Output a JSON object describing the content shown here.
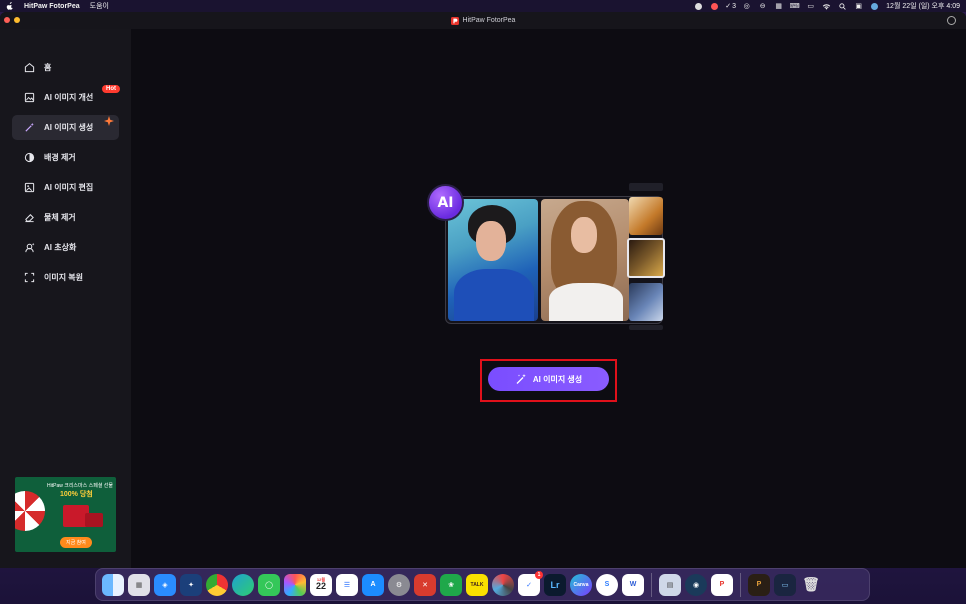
{
  "menubar": {
    "app_name": "HitPaw FotorPea",
    "menus": [
      "도움이"
    ],
    "badge_count": "3",
    "clock": "12월 22일 (일) 오후 4:09"
  },
  "window": {
    "title": "HitPaw FotorPea"
  },
  "sidebar": {
    "items": [
      {
        "label": "홈",
        "icon": "home-icon"
      },
      {
        "label": "AI 이미지 개선",
        "icon": "image-enhance-icon",
        "badge": "Hot"
      },
      {
        "label": "AI 이미지 생성",
        "icon": "magic-wand-icon",
        "active": true
      },
      {
        "label": "배경 제거",
        "icon": "background-remove-icon"
      },
      {
        "label": "AI 이미지 편집",
        "icon": "image-edit-icon"
      },
      {
        "label": "물체 제거",
        "icon": "eraser-icon"
      },
      {
        "label": "AI 초상화",
        "icon": "portrait-icon"
      },
      {
        "label": "이미지 복원",
        "icon": "restore-icon"
      }
    ],
    "promo": {
      "title": "HitPaw 크리스마스 스페셜 선물",
      "headline": "100% 당첨",
      "button": "지금 참여"
    }
  },
  "main": {
    "ai_badge": "AI",
    "cta_label": "AI 이미지 생성",
    "accent_color": "#7a4dff",
    "highlight_color": "#e0101a"
  },
  "dock": {
    "calendar_month": "12월",
    "calendar_day": "22",
    "lightroom_label": "Lr",
    "canva_label": "Canva",
    "kakao_label": "TALK",
    "word_label": "W",
    "notification_count": "1"
  }
}
